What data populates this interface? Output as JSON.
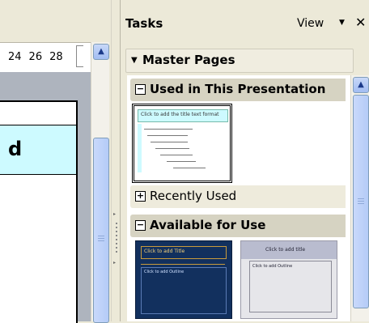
{
  "ruler": {
    "numbers": [
      "24",
      "26",
      "28"
    ]
  },
  "slide": {
    "visible_char": "d"
  },
  "tasks": {
    "title": "Tasks",
    "view_label": "View",
    "view_arrow": "▼",
    "close_glyph": "✕",
    "master_pages_label": "Master Pages",
    "master_pages_expander": "▼",
    "sections": {
      "used": {
        "label": "Used in This Presentation",
        "toggle": "−"
      },
      "recent": {
        "label": "Recently Used",
        "toggle": "+"
      },
      "available": {
        "label": "Available for Use",
        "toggle": "−"
      }
    },
    "thumbnails": {
      "used_title": "Click to add the title text format",
      "blue_title": "Click to add Title",
      "blue_body": "Click to add Outline",
      "grey_title": "Click to add title",
      "grey_body": "Click to add Outline"
    },
    "scroll_up_glyph": "▲"
  }
}
